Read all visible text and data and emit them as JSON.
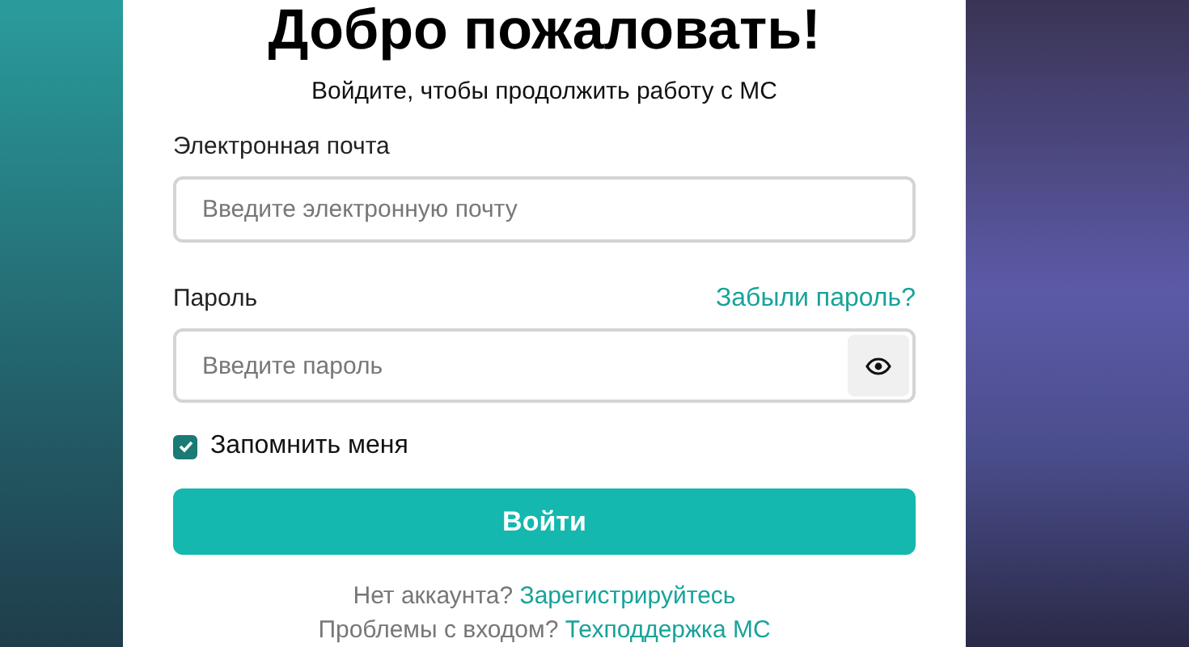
{
  "title": "Добро пожаловать!",
  "subtitle": "Войдите, чтобы продолжить работу с МС",
  "email": {
    "label": "Электронная почта",
    "placeholder": "Введите электронную почту"
  },
  "password": {
    "label": "Пароль",
    "forgot_link": "Забыли пароль?",
    "placeholder": "Введите пароль"
  },
  "remember": {
    "label": "Запомнить меня",
    "checked": true
  },
  "submit": "Войти",
  "footer": [
    {
      "text": "Нет аккаунта?",
      "link": "Зарегистрируйтесь"
    },
    {
      "text": "Проблемы с входом?",
      "link": "Техподдержка МС"
    }
  ]
}
